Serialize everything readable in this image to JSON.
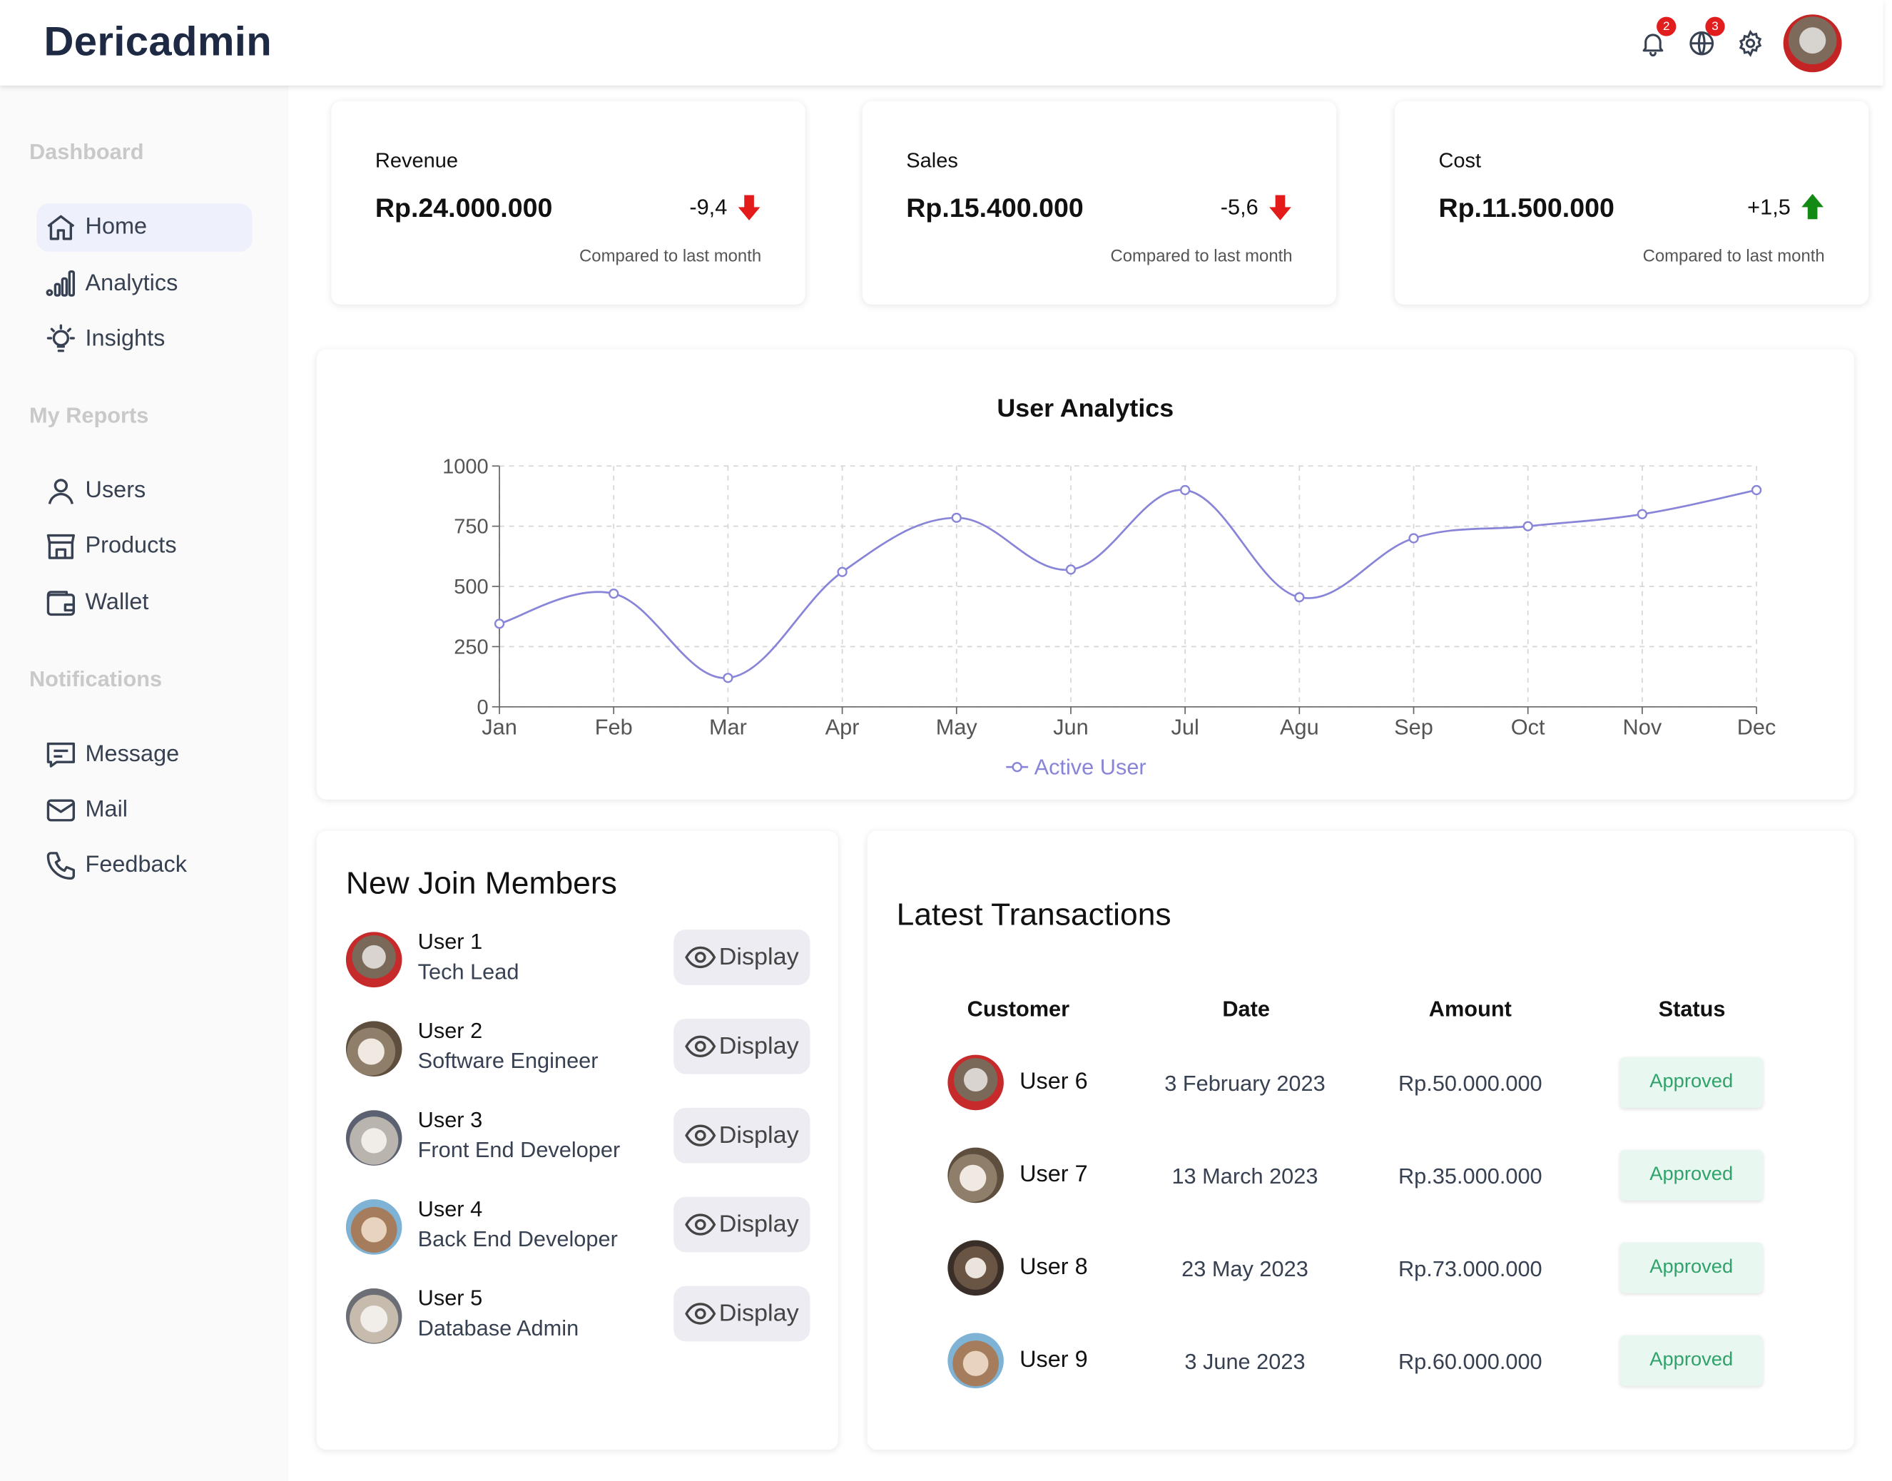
{
  "app": {
    "title": "Dericadmin"
  },
  "topbar": {
    "notifications_badge": "2",
    "language_badge": "3"
  },
  "sidebar": {
    "sections": [
      {
        "heading": "Dashboard",
        "items": [
          {
            "label": "Home",
            "icon": "home-icon",
            "active": true
          },
          {
            "label": "Analytics",
            "icon": "bar-chart-icon"
          },
          {
            "label": "Insights",
            "icon": "lightbulb-icon"
          }
        ]
      },
      {
        "heading": "My Reports",
        "items": [
          {
            "label": "Users",
            "icon": "user-icon"
          },
          {
            "label": "Products",
            "icon": "store-icon"
          },
          {
            "label": "Wallet",
            "icon": "wallet-icon"
          }
        ]
      },
      {
        "heading": "Notifications",
        "items": [
          {
            "label": "Message",
            "icon": "message-icon"
          },
          {
            "label": "Mail",
            "icon": "mail-icon"
          },
          {
            "label": "Feedback",
            "icon": "phone-icon"
          }
        ]
      }
    ]
  },
  "kpis": [
    {
      "label": "Revenue",
      "value": "Rp.24.000.000",
      "delta": "-9,4",
      "trend": "down",
      "compare": "Compared to last month"
    },
    {
      "label": "Sales",
      "value": "Rp.15.400.000",
      "delta": "-5,6",
      "trend": "down",
      "compare": "Compared to last month"
    },
    {
      "label": "Cost",
      "value": "Rp.11.500.000",
      "delta": "+1,5",
      "trend": "up",
      "compare": "Compared to last month"
    }
  ],
  "chart_data": {
    "type": "line",
    "title": "User Analytics",
    "x": [
      "Jan",
      "Feb",
      "Mar",
      "Apr",
      "May",
      "Jun",
      "Jul",
      "Agu",
      "Sep",
      "Oct",
      "Nov",
      "Dec"
    ],
    "series": [
      {
        "name": "Active User",
        "values": [
          345,
          470,
          120,
          560,
          785,
          570,
          900,
          455,
          700,
          750,
          800,
          900
        ],
        "color": "#8884d8"
      }
    ],
    "yticks": [
      "1000",
      "750",
      "500",
      "250",
      "0"
    ],
    "ylim": [
      0,
      1000
    ],
    "grid": true,
    "legend": "bottom"
  },
  "members": {
    "title": "New Join Members",
    "button_label": "Display",
    "items": [
      {
        "name": "User 1",
        "role": "Tech Lead"
      },
      {
        "name": "User 2",
        "role": "Software Engineer"
      },
      {
        "name": "User 3",
        "role": "Front End Developer"
      },
      {
        "name": "User 4",
        "role": "Back End Developer"
      },
      {
        "name": "User 5",
        "role": "Database Admin"
      }
    ]
  },
  "transactions": {
    "title": "Latest Transactions",
    "columns": [
      "Customer",
      "Date",
      "Amount",
      "Status"
    ],
    "rows": [
      {
        "customer": "User 6",
        "date": "3 February 2023",
        "amount": "Rp.50.000.000",
        "status": "Approved"
      },
      {
        "customer": "User 7",
        "date": "13 March 2023",
        "amount": "Rp.35.000.000",
        "status": "Approved"
      },
      {
        "customer": "User 8",
        "date": "23 May 2023",
        "amount": "Rp.73.000.000",
        "status": "Approved"
      },
      {
        "customer": "User 9",
        "date": "3 June 2023",
        "amount": "Rp.60.000.000",
        "status": "Approved"
      }
    ]
  },
  "colors": {
    "down": "#e31b1b",
    "up": "#138a13",
    "accent": "#8884d8",
    "approved_bg": "#e8f7ef",
    "approved_text": "#2fa36b"
  }
}
